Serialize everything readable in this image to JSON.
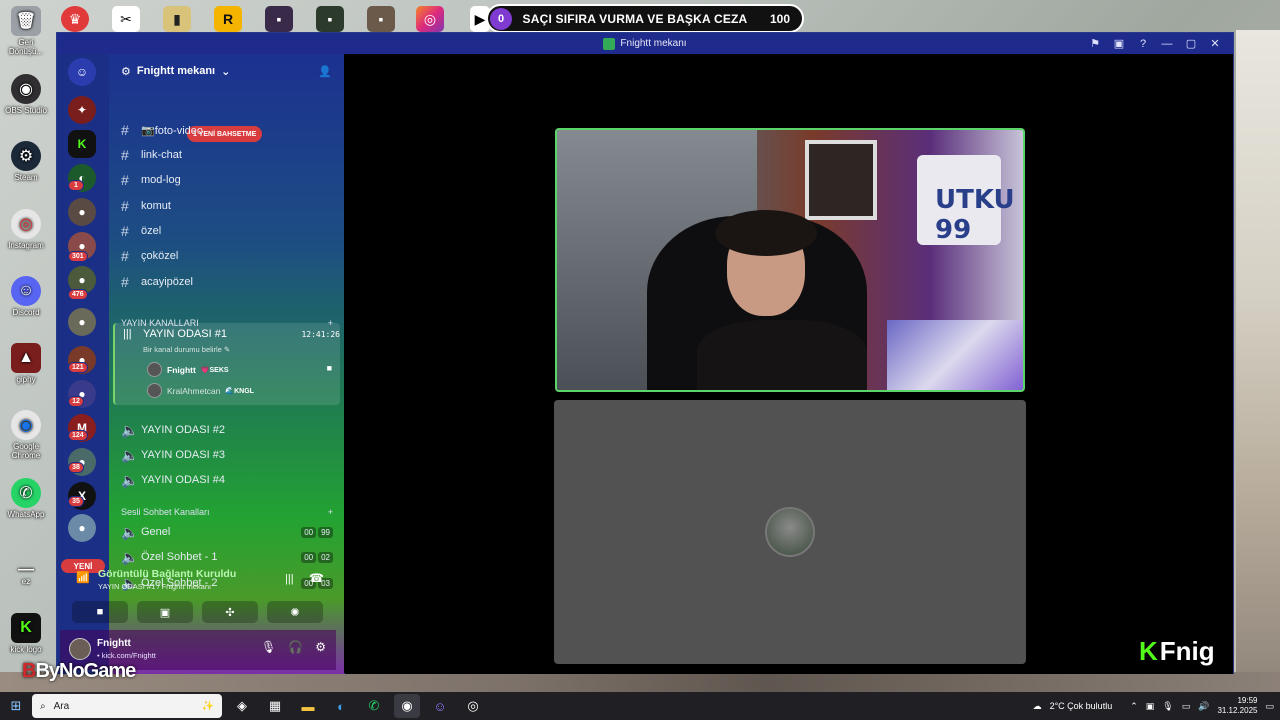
{
  "overlay": {
    "left_count": "0",
    "text": "SAÇI SIFIRA VURMA VE BAŞKA CEZA",
    "right_count": "100"
  },
  "desktop_icons": [
    {
      "label": "Geri Dönüşü...",
      "icon": "recycle-bin-icon",
      "color": "#9aa0a6"
    },
    {
      "label": "OBS Studio",
      "icon": "obs-icon",
      "color": "#302e31"
    },
    {
      "label": "Steam",
      "icon": "steam-icon",
      "color": "#1b2838"
    },
    {
      "label": "Instagram",
      "icon": "chrome-instagram-icon",
      "color": "#e6e6e6"
    },
    {
      "label": "Discord",
      "icon": "discord-icon",
      "color": "#5865f2"
    },
    {
      "label": "giphy",
      "icon": "giphy-icon",
      "color": "#7a1d1d"
    },
    {
      "label": "Google Chrome",
      "icon": "chrome-icon",
      "color": "#e6e6e6"
    },
    {
      "label": "WhatsApp",
      "icon": "whatsapp-icon",
      "color": "#25d366"
    },
    {
      "label": "ez",
      "icon": "ez-icon",
      "color": "#4a4a4a"
    },
    {
      "label": "kick logo",
      "icon": "kick-icon",
      "color": "#111111"
    }
  ],
  "window": {
    "title": "Fnightt mekanı"
  },
  "guild": {
    "name": "Fnightt mekanı",
    "mention_pill": "1 YENİ BAHSETME"
  },
  "servers": {
    "badges": [
      "1",
      "301",
      "476",
      "121",
      "12",
      "124",
      "38",
      "35"
    ],
    "new_label": "YENİ"
  },
  "channels": {
    "text": [
      {
        "name": "📷foto-video"
      },
      {
        "name": "link-chat"
      },
      {
        "name": "mod-log"
      },
      {
        "name": "komut"
      },
      {
        "name": "özel"
      },
      {
        "name": "çoközel"
      },
      {
        "name": "acayipözel"
      }
    ],
    "category_stream": "YAYIN KANALLARI",
    "active_voice": {
      "name": "YAYIN ODASI #1",
      "time": "12:41:26",
      "status": "Bir kanal durumu belirle",
      "users": [
        {
          "name": "Fnightt",
          "tag": "💗SEKS"
        },
        {
          "name": "KralAhmetcan",
          "tag": "🌊KNGL"
        }
      ]
    },
    "stream_rooms": [
      "YAYIN ODASI #2",
      "YAYIN ODASI #3",
      "YAYIN ODASI #4"
    ],
    "category_voice": "Sesli Sohbet Kanalları",
    "voice_rooms": [
      {
        "name": "Genel",
        "a": "00",
        "b": "99"
      },
      {
        "name": "Özel Sohbet - 1",
        "a": "00",
        "b": "02"
      },
      {
        "name": "Özel Sohbet - 2",
        "a": "00",
        "b": "03"
      }
    ]
  },
  "voice_panel": {
    "title": "Görüntülü Bağlantı Kuruldu",
    "subtitle": "YAYIN ODASI #1 / Fnightt mekanı"
  },
  "user_panel": {
    "name": "Fnightt",
    "status": "• kick.com/Fnightt"
  },
  "video": {
    "shirt_text": "UTKU 99"
  },
  "watermark": {
    "k": "K",
    "text": "Fnig"
  },
  "bg_logo": {
    "b": "B",
    "text": "ByNoGame"
  },
  "taskbar": {
    "search_placeholder": "Ara",
    "weather": "2°C  Çok bulutlu",
    "time": "19:59",
    "date": "31.12.2025"
  }
}
